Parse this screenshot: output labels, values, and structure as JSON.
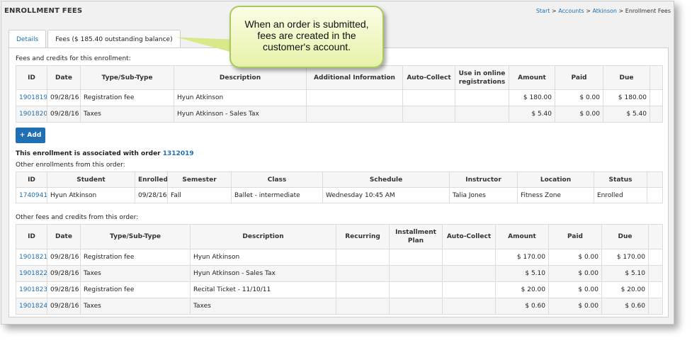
{
  "page": {
    "title": "ENROLLMENT FEES",
    "breadcrumb": [
      "Start",
      "Accounts",
      "Atkinson",
      "Enrollment Fees"
    ]
  },
  "callout": {
    "text": "When an order is submitted, fees are created in the customer's account."
  },
  "tabs": [
    {
      "label": "Details",
      "active": false
    },
    {
      "label": "Fees ($ 185.40 outstanding balance)",
      "active": true
    }
  ],
  "fees_section": {
    "label": "Fees and credits for this enrollment:",
    "columns": [
      "ID",
      "Date",
      "Type/Sub-Type",
      "Description",
      "Additional Information",
      "Auto-Collect",
      "Use in online registrations",
      "Amount",
      "Paid",
      "Due",
      ""
    ],
    "rows": [
      {
        "id": "1901819",
        "date": "09/28/16",
        "type": "Registration fee",
        "description": "Hyun Atkinson",
        "additional": "",
        "auto": "",
        "online": "",
        "amount": "$ 180.00",
        "paid": "$ 0.00",
        "due": "$ 180.00"
      },
      {
        "id": "1901820",
        "date": "09/28/16",
        "type": "Taxes",
        "description": "Hyun Atkinson - Sales Tax",
        "additional": "",
        "auto": "",
        "online": "",
        "amount": "$ 5.40",
        "paid": "$ 0.00",
        "due": "$ 5.40"
      }
    ],
    "add_label": "+ Add"
  },
  "order": {
    "text": "This enrollment is associated with order",
    "number": "1312019"
  },
  "enrollments_section": {
    "label": "Other enrollments from this order:",
    "columns": [
      "ID",
      "Student",
      "Enrolled",
      "Semester",
      "Class",
      "Schedule",
      "Instructor",
      "Location",
      "Status",
      ""
    ],
    "rows": [
      {
        "id": "1740941",
        "student": "Hyun Atkinson",
        "enrolled": "09/28/16",
        "semester": "Fall",
        "class": "Ballet - intermediate",
        "schedule": "Wednesday 10:45 AM",
        "instructor": "Talia Jones",
        "location": "Fitness Zone",
        "status": "Enrolled"
      }
    ]
  },
  "other_fees_section": {
    "label": "Other fees and credits from this order:",
    "columns": [
      "ID",
      "Date",
      "Type/Sub-Type",
      "Description",
      "Recurring",
      "Installment Plan",
      "Auto-Collect",
      "Amount",
      "Paid",
      "Due",
      ""
    ],
    "rows": [
      {
        "id": "1901821",
        "date": "09/28/16",
        "type": "Registration fee",
        "description": "Hyun Atkinson",
        "amount": "$ 170.00",
        "paid": "$ 0.00",
        "due": "$ 170.00"
      },
      {
        "id": "1901822",
        "date": "09/28/16",
        "type": "Taxes",
        "description": "Hyun Atkinson - Sales Tax",
        "amount": "$ 5.10",
        "paid": "$ 0.00",
        "due": "$ 5.10"
      },
      {
        "id": "1901823",
        "date": "09/28/16",
        "type": "Registration fee",
        "description": "Recital Ticket - 11/10/11",
        "amount": "$ 20.00",
        "paid": "$ 0.00",
        "due": "$ 20.00"
      },
      {
        "id": "1901824",
        "date": "09/28/16",
        "type": "Taxes",
        "description": "Taxes",
        "amount": "$ 0.60",
        "paid": "$ 0.00",
        "due": "$ 0.60"
      }
    ]
  },
  "colors": {
    "link": "#1f6fb2",
    "callout_border": "#a7c95e",
    "button": "#1f6fb2"
  }
}
